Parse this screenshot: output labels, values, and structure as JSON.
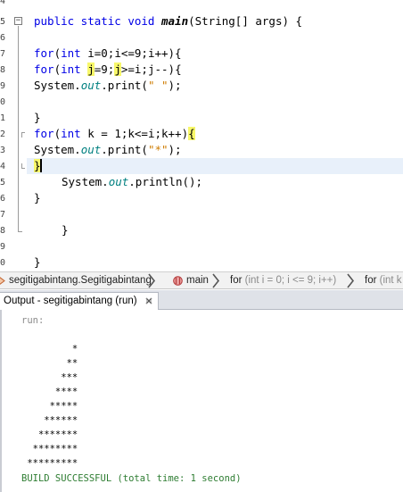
{
  "gutter": {
    "line_numbers": [
      "4",
      "5",
      "6",
      "7",
      "8",
      "9",
      "0",
      "1",
      "2",
      "3",
      "4",
      "5",
      "6",
      "7",
      "8",
      "9",
      "0"
    ]
  },
  "code": {
    "signature": {
      "modifiers": "public static void ",
      "method": "main",
      "params": "(String[] args) {"
    },
    "outer_for": {
      "kw1": "for",
      "p1": "(",
      "kw2": "int",
      "rest": " i=0;i<=9;i++){"
    },
    "inner_for": {
      "kw1": "for",
      "p1": "(",
      "kw2": "int",
      "sp": " ",
      "var1": "j",
      "mid": "=9;",
      "var2": "j",
      "rest": ">=i;j--){"
    },
    "print_space": {
      "obj": "System.",
      "field": "out",
      "call": ".print(",
      "arg": "\" \"",
      "end": ");"
    },
    "close1": "}",
    "k_for": {
      "kw1": "for",
      "p1": "(",
      "kw2": "int",
      "rest": " k = 1;k<=i;k++)",
      "brace": "{"
    },
    "print_star": {
      "obj": "System.",
      "field": "out",
      "call": ".print(",
      "arg": "\"*\"",
      "end": ");"
    },
    "close_matched": "}",
    "println": {
      "obj": "System.",
      "field": "out",
      "call": ".println();"
    },
    "close2": "}",
    "close3": "}",
    "close4": "}"
  },
  "breadcrumb": {
    "items": [
      {
        "label": "segitigabintang.Segitigabintang"
      },
      {
        "label": "main"
      },
      {
        "label": "for ",
        "detail": "(int i = 0; i <= 9; i++)"
      },
      {
        "label": "for ",
        "detail": "(int k"
      }
    ]
  },
  "output": {
    "tab_label": "Output - segitigabintang (run)",
    "run_label": "run:",
    "lines": [
      "         *",
      "        **",
      "       ***",
      "      ****",
      "     *****",
      "    ******",
      "   *******",
      "  ********",
      " *********"
    ],
    "status": "BUILD SUCCESSFUL (total time: 1 second)"
  },
  "colors": {
    "keyword": "#0000e6",
    "field": "#008080",
    "string": "#ce7b00",
    "match_highlight": "#f7f76a",
    "current_line": "#e8f0fa",
    "success": "#2e7d32"
  }
}
